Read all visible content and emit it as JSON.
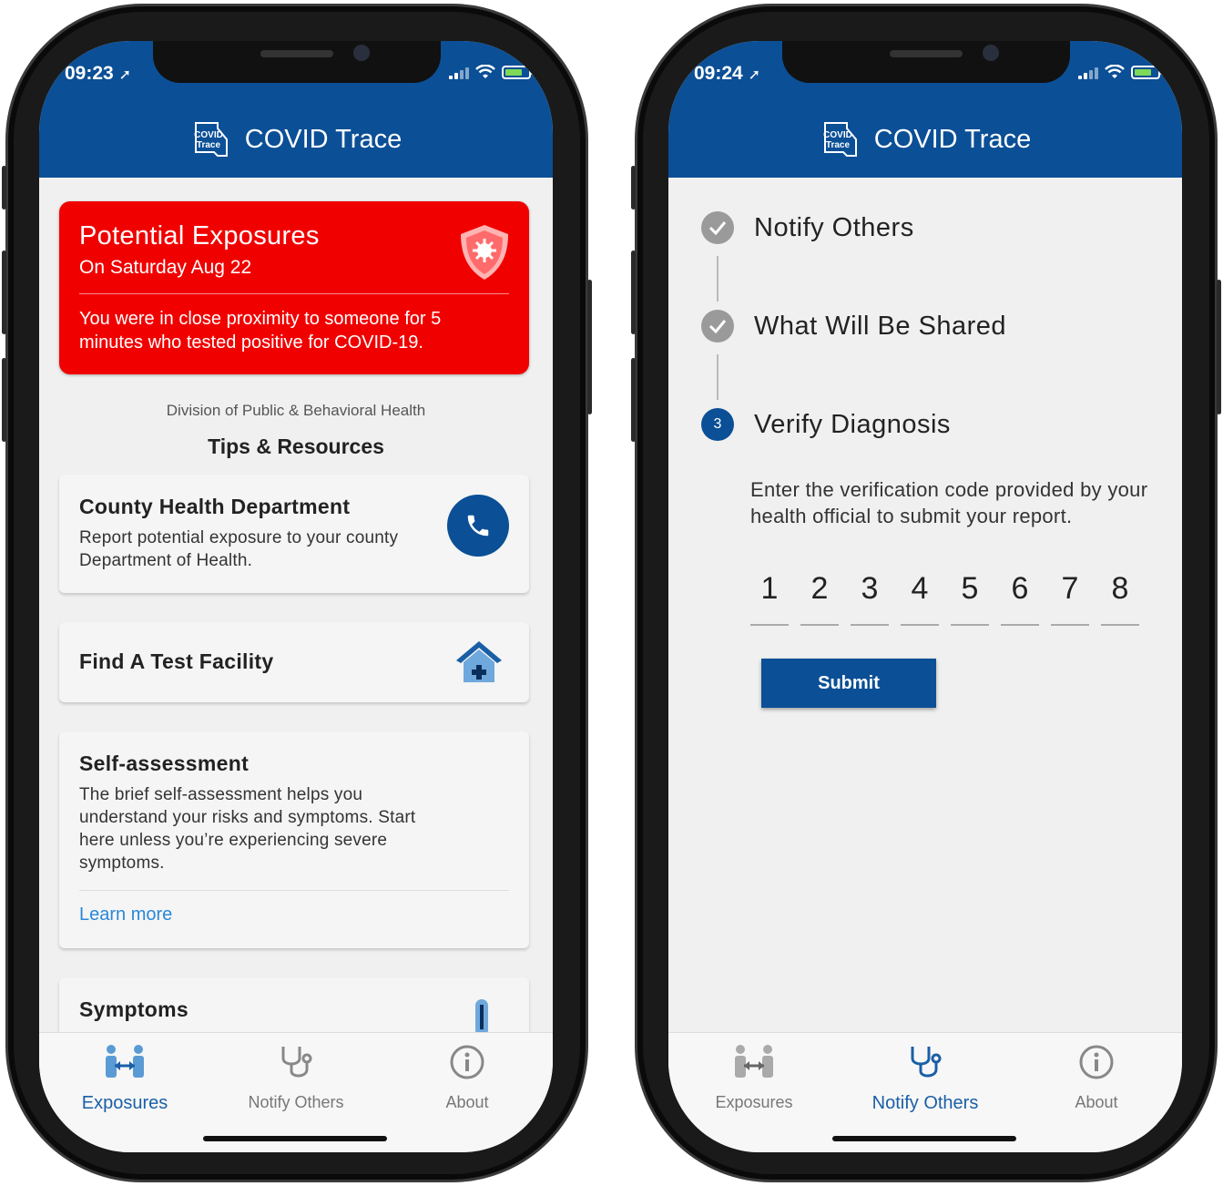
{
  "left": {
    "status": {
      "time": "09:23"
    },
    "app_title": "COVID Trace",
    "logo_text": [
      "COVID",
      "Trace"
    ],
    "alert": {
      "title": "Potential Exposures",
      "date": "On Saturday Aug 22",
      "message": "You were in close proximity to someone for 5 minutes who tested positive for COVID-19."
    },
    "division": "Division of Public & Behavioral Health",
    "tips_title": "Tips & Resources",
    "cards": {
      "county": {
        "title": "County Health Department",
        "desc": "Report potential exposure to your county Department of Health.",
        "icon": "phone-icon"
      },
      "facility": {
        "title": "Find A Test Facility",
        "icon": "hospital-icon"
      },
      "self": {
        "title": "Self-assessment",
        "desc": "The brief self-assessment helps you understand your risks and symptoms. Start here unless you’re experiencing severe symptoms.",
        "link": "Learn more"
      },
      "symptoms": {
        "title": "Symptoms",
        "icon": "thermometer-icon"
      }
    },
    "tabs": [
      {
        "label": "Exposures",
        "icon": "exposures-icon",
        "active": true
      },
      {
        "label": "Notify Others",
        "icon": "stethoscope-icon",
        "active": false
      },
      {
        "label": "About",
        "icon": "info-icon",
        "active": false
      }
    ]
  },
  "right": {
    "status": {
      "time": "09:24"
    },
    "app_title": "COVID Trace",
    "logo_text": [
      "COVID",
      "Trace"
    ],
    "steps": [
      {
        "label": "Notify Others",
        "state": "done"
      },
      {
        "label": "What Will Be Shared",
        "state": "done"
      },
      {
        "number": "3",
        "label": "Verify Diagnosis",
        "state": "current"
      }
    ],
    "verify_text": "Enter the verification code provided by your health official to submit your report.",
    "code_digits": [
      "1",
      "2",
      "3",
      "4",
      "5",
      "6",
      "7",
      "8"
    ],
    "submit_label": "Submit",
    "tabs": [
      {
        "label": "Exposures",
        "icon": "exposures-icon",
        "active": false
      },
      {
        "label": "Notify Others",
        "icon": "stethoscope-icon",
        "active": true
      },
      {
        "label": "About",
        "icon": "info-icon",
        "active": false
      }
    ]
  },
  "colors": {
    "header": "#0b4f96",
    "alert": "#f10000",
    "link": "#2a88d8",
    "active_tab": "#1a5fa6"
  }
}
